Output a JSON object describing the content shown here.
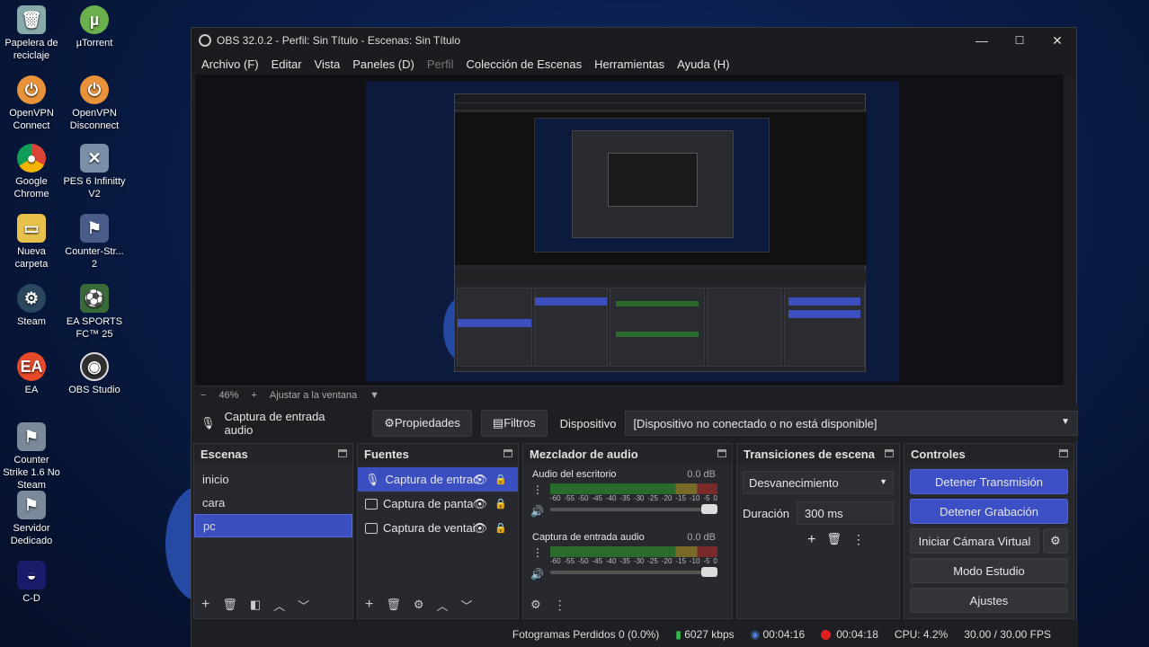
{
  "desktop": {
    "icons": [
      {
        "label": "Papelera de reciclaje",
        "icon": "recycle-bin-icon"
      },
      {
        "label": "µTorrent",
        "icon": "utorrent-icon"
      },
      {
        "label": "OpenVPN Connect",
        "icon": "openvpn-icon"
      },
      {
        "label": "OpenVPN Disconnect",
        "icon": "openvpn-icon"
      },
      {
        "label": "Google Chrome",
        "icon": "chrome-icon"
      },
      {
        "label": "PES 6 Infinitty V2",
        "icon": "pes-icon"
      },
      {
        "label": "Nueva carpeta",
        "icon": "folder-icon"
      },
      {
        "label": "Counter-Str... 2",
        "icon": "counter-strike-icon"
      },
      {
        "label": "Steam",
        "icon": "steam-icon"
      },
      {
        "label": "EA SPORTS FC™ 25",
        "icon": "ea-sports-icon"
      },
      {
        "label": "EA",
        "icon": "ea-icon"
      },
      {
        "label": "OBS Studio",
        "icon": "obs-icon"
      },
      {
        "label": "Counter Strike 1.6 No Steam",
        "icon": "counter-strike-icon"
      },
      {
        "label": "Servidor Dedicado",
        "icon": "server-icon"
      },
      {
        "label": "C-D",
        "icon": "cd-icon"
      }
    ]
  },
  "window": {
    "title": "OBS 32.0.2 - Perfil: Sin Título - Escenas: Sin Título",
    "minimize": "—",
    "maximize": "☐",
    "close": "✕"
  },
  "menu": [
    "Archivo (F)",
    "Editar",
    "Vista",
    "Paneles (D)",
    "Perfil",
    "Colección de Escenas",
    "Herramientas",
    "Ayuda (H)"
  ],
  "zoom": {
    "minus": "−",
    "value": "46%",
    "plus": "+",
    "fit": "Ajustar a la ventana"
  },
  "source_bar": {
    "source_name": "Captura de entrada audio",
    "properties": "Propiedades",
    "filters": "Filtros",
    "device_label": "Dispositivo",
    "device_value": "[Dispositivo no conectado o no está disponible]"
  },
  "scenes": {
    "title": "Escenas",
    "items": [
      "inicio",
      "cara",
      "pc"
    ],
    "selected": "pc"
  },
  "sources": {
    "title": "Fuentes",
    "items": [
      "Captura de entrac",
      "Captura de panta",
      "Captura de ventai"
    ]
  },
  "mixer": {
    "title": "Mezclador de audio",
    "channels": [
      {
        "name": "Audio del escritorio",
        "db": "0.0 dB"
      },
      {
        "name": "Captura de entrada audio",
        "db": "0.0 dB"
      }
    ],
    "ticks": [
      "-60",
      "-55",
      "-50",
      "-45",
      "-40",
      "-35",
      "-30",
      "-25",
      "-20",
      "-15",
      "-10",
      "-5",
      "0"
    ]
  },
  "transitions": {
    "title": "Transiciones de escena",
    "selected": "Desvanecimiento",
    "duration_label": "Duración",
    "duration_value": "300 ms"
  },
  "controls": {
    "title": "Controles",
    "stop_stream": "Detener Transmisión",
    "stop_record": "Detener Grabación",
    "virtual_cam": "Iniciar Cámara Virtual",
    "studio_mode": "Modo Estudio",
    "settings": "Ajustes"
  },
  "status": {
    "dropped": "Fotogramas Perdidos 0 (0.0%)",
    "bitrate": "6027 kbps",
    "stream_time": "00:04:16",
    "rec_time": "00:04:18",
    "cpu": "CPU: 4.2%",
    "fps": "30.00 / 30.00 FPS"
  },
  "colors": {
    "accent": "#3b4fc1",
    "record": "#e02020",
    "stream": "#4a7bd8",
    "bitrate": "#2fbf4a"
  }
}
